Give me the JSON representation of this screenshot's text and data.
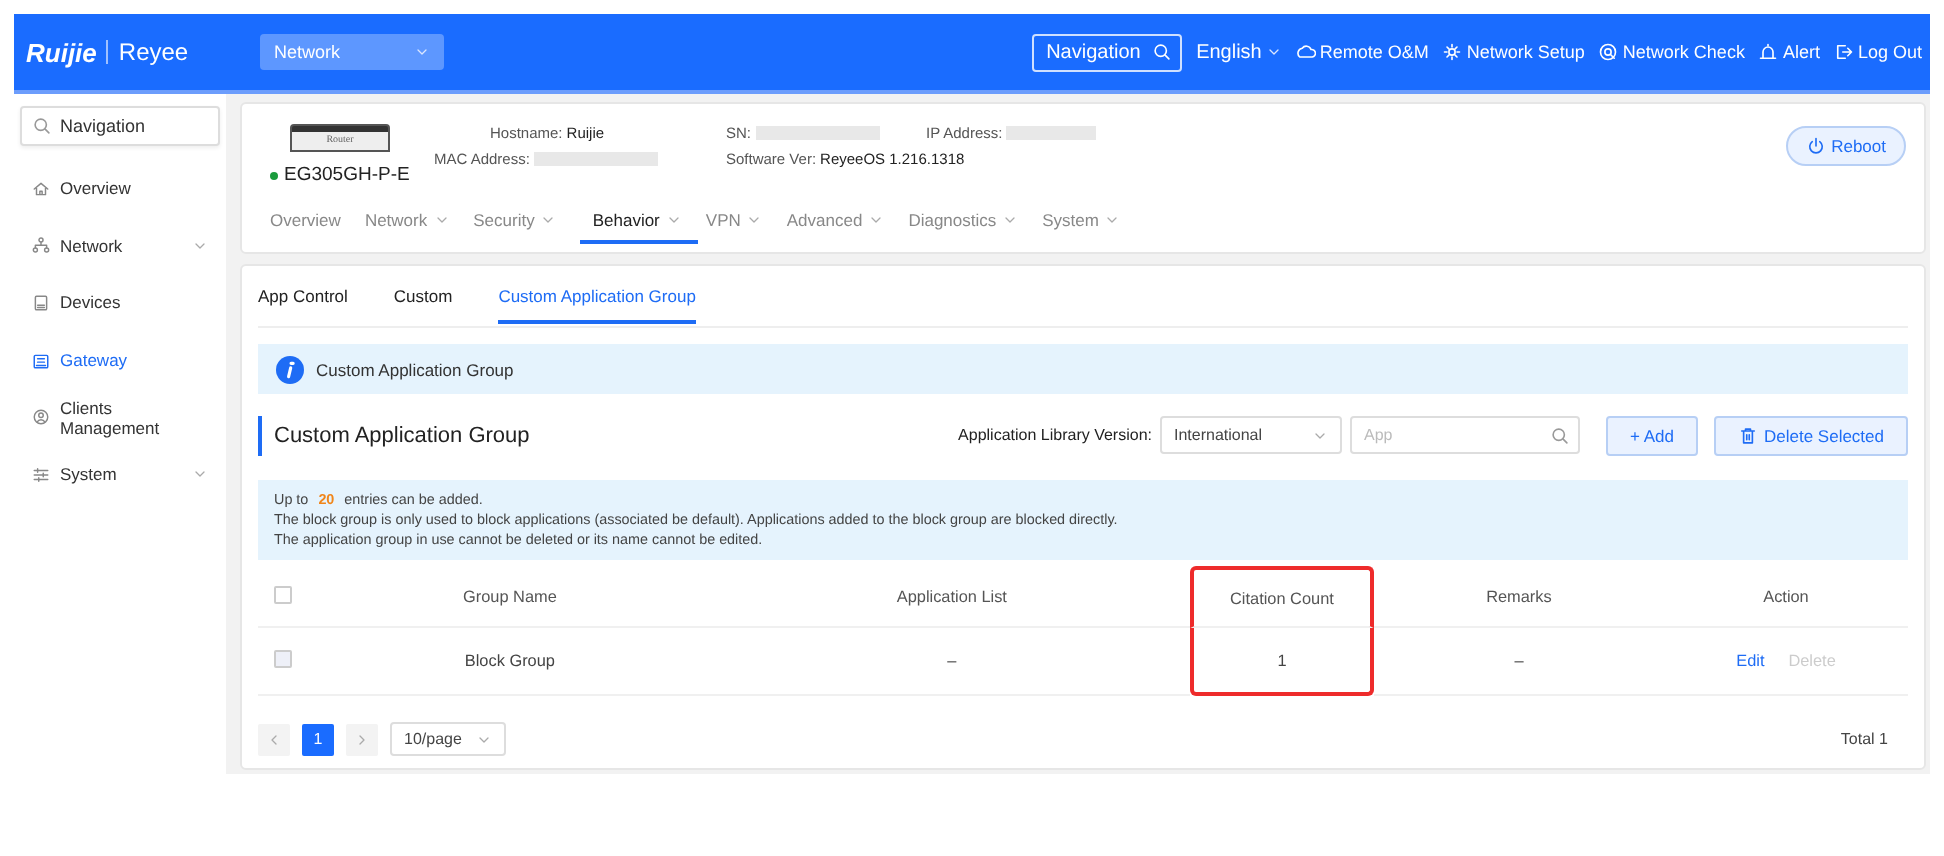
{
  "topbar": {
    "logo": "Ruijie",
    "logo_sub": "Reyee",
    "scope": "Network",
    "search": {
      "placeholder": "Navigation"
    },
    "language": "English",
    "links": [
      {
        "label": "Remote O&M"
      },
      {
        "label": "Network Setup"
      },
      {
        "label": "Network Check"
      },
      {
        "label": "Alert"
      },
      {
        "label": "Log Out"
      }
    ]
  },
  "sidebar": {
    "search": {
      "placeholder": "Navigation"
    },
    "items": [
      {
        "label": "Overview",
        "selected": false,
        "expandable": false
      },
      {
        "label": "Network",
        "selected": false,
        "expandable": true
      },
      {
        "label": "Devices",
        "selected": false,
        "expandable": false
      },
      {
        "label": "Gateway",
        "selected": true,
        "expandable": false
      },
      {
        "label": "Clients Management",
        "selected": false,
        "expandable": false
      },
      {
        "label": "System",
        "selected": false,
        "expandable": true
      }
    ]
  },
  "device": {
    "image_label": "Router",
    "online": true,
    "model": "EG305GH-P-E",
    "fields": [
      {
        "label": "Hostname:",
        "value": "Ruijie",
        "redacted": false
      },
      {
        "label": "SN:",
        "redacted": true
      },
      {
        "label": "IP Address:",
        "redacted": true
      },
      {
        "label": "MAC Address:",
        "redacted": true
      },
      {
        "label": "Software Ver:",
        "value": "ReyeeOS 1.216.1318",
        "redacted": false
      }
    ],
    "reboot": "Reboot"
  },
  "menu": [
    {
      "label": "Overview",
      "selected": false,
      "dropdown": false
    },
    {
      "label": "Network",
      "selected": false,
      "dropdown": true
    },
    {
      "label": "Security",
      "selected": false,
      "dropdown": true
    },
    {
      "label": "Behavior",
      "selected": true,
      "dropdown": true
    },
    {
      "label": "VPN",
      "selected": false,
      "dropdown": true
    },
    {
      "label": "Advanced",
      "selected": false,
      "dropdown": true
    },
    {
      "label": "Diagnostics",
      "selected": false,
      "dropdown": true
    },
    {
      "label": "System",
      "selected": false,
      "dropdown": true
    }
  ],
  "tabs": [
    {
      "label": "App Control",
      "selected": false
    },
    {
      "label": "Custom",
      "selected": false
    },
    {
      "label": "Custom Application Group",
      "selected": true
    }
  ],
  "info": "Custom Application Group",
  "section": {
    "title": "Custom Application Group",
    "library_label": "Application Library Version:",
    "library_value": "International",
    "search": {
      "placeholder": "App"
    },
    "add": "+ Add",
    "delete": "Delete Selected"
  },
  "notice": {
    "prefix": "Up to",
    "count": "20",
    "suffix": "entries can be added.",
    "lines": [
      "The block group is only used to block applications (associated be default). Applications added to the block group are blocked directly.",
      "The application group in use cannot be deleted or its name cannot be edited."
    ]
  },
  "table": {
    "columns": [
      {
        "label": "Group Name",
        "highlighted": false
      },
      {
        "label": "Application List",
        "highlighted": false
      },
      {
        "label": "Citation Count",
        "highlighted": true
      },
      {
        "label": "Remarks",
        "highlighted": false
      },
      {
        "label": "Action",
        "highlighted": false
      }
    ],
    "header_checked": false,
    "rows": [
      {
        "checked": false,
        "cells": [
          "Block Group",
          "–",
          "1",
          "–"
        ],
        "actions": [
          {
            "label": "Edit",
            "disabled": false
          },
          {
            "label": "Delete",
            "disabled": true
          }
        ]
      }
    ]
  },
  "pagination": {
    "pages": [
      {
        "label": "1",
        "selected": true
      }
    ],
    "page_size": "10/page",
    "total": "Total 1"
  }
}
